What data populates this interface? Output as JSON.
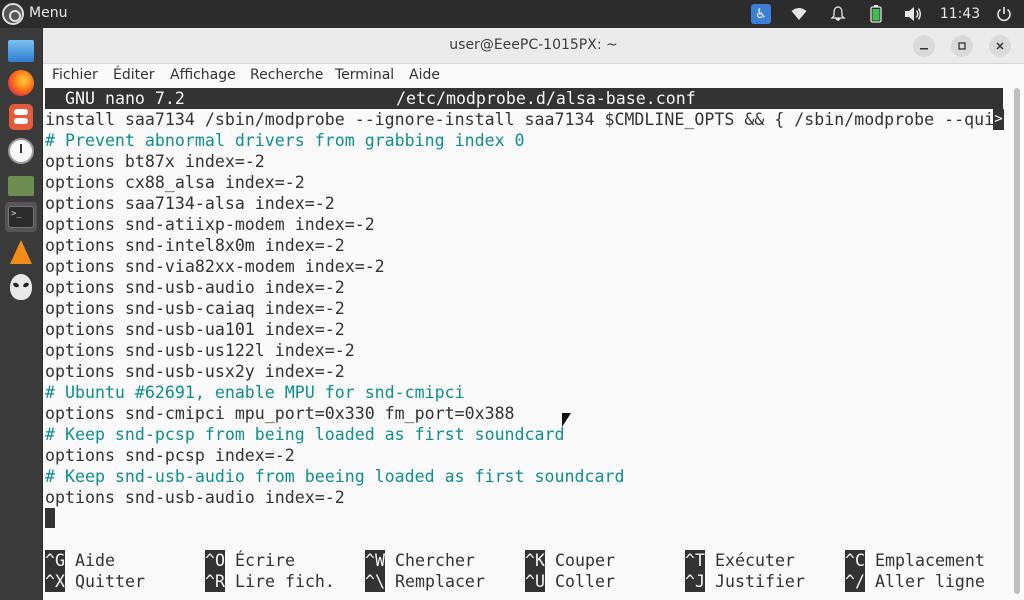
{
  "panel": {
    "menu_label": "Menu",
    "clock": "11:43",
    "icons": [
      "accessibility-icon",
      "wifi-icon",
      "notification-bell-icon",
      "battery-icon",
      "volume-icon",
      "power-icon"
    ]
  },
  "dock": {
    "apps": [
      "files",
      "firefox",
      "settings",
      "clock",
      "file-manager",
      "terminal",
      "vlc",
      "alien"
    ]
  },
  "window": {
    "title": "user@EeePC-1015PX: ~",
    "menus": [
      "Fichier",
      "Éditer",
      "Affichage",
      "Recherche",
      "Terminal",
      "Aide"
    ]
  },
  "nano": {
    "version": "GNU nano 7.2",
    "filename": "/etc/modprobe.d/alsa-base.conf",
    "lines": [
      "install saa7134 /sbin/modprobe --ignore-install saa7134 $CMDLINE_OPTS && { /sbin/modprobe --qui",
      "# Prevent abnormal drivers from grabbing index 0",
      "options bt87x index=-2",
      "options cx88_alsa index=-2",
      "options saa7134-alsa index=-2",
      "options snd-atiixp-modem index=-2",
      "options snd-intel8x0m index=-2",
      "options snd-via82xx-modem index=-2",
      "options snd-usb-audio index=-2",
      "options snd-usb-caiaq index=-2",
      "options snd-usb-ua101 index=-2",
      "options snd-usb-us122l index=-2",
      "options snd-usb-usx2y index=-2",
      "# Ubuntu #62691, enable MPU for snd-cmipci",
      "options snd-cmipci mpu_port=0x330 fm_port=0x388",
      "# Keep snd-pcsp from being loaded as first soundcard",
      "options snd-pcsp index=-2",
      "# Keep snd-usb-audio from beeing loaded as first soundcard",
      "options snd-usb-audio index=-2"
    ],
    "overflow_marker": ">",
    "shortcuts_row1": [
      {
        "key": "^G",
        "label": "Aide"
      },
      {
        "key": "^O",
        "label": "Écrire"
      },
      {
        "key": "^W",
        "label": "Chercher"
      },
      {
        "key": "^K",
        "label": "Couper"
      },
      {
        "key": "^T",
        "label": "Exécuter"
      },
      {
        "key": "^C",
        "label": "Emplacement"
      }
    ],
    "shortcuts_row2": [
      {
        "key": "^X",
        "label": "Quitter"
      },
      {
        "key": "^R",
        "label": "Lire fich."
      },
      {
        "key": "^\\",
        "label": "Remplacer"
      },
      {
        "key": "^U",
        "label": "Coller"
      },
      {
        "key": "^J",
        "label": "Justifier"
      },
      {
        "key": "^/",
        "label": "Aller ligne"
      }
    ]
  },
  "colors": {
    "comment": "#0f8f8f",
    "text": "#333333",
    "header_bg": "#333333",
    "accent": "#3d7fd6"
  }
}
